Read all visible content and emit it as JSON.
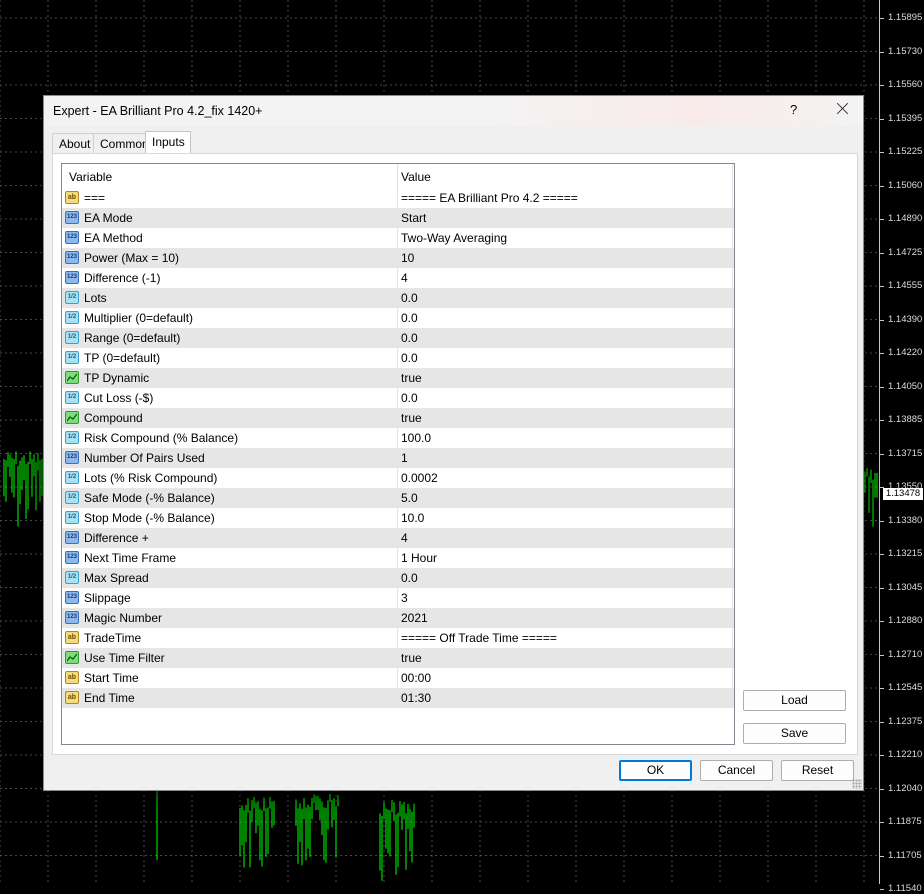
{
  "chart": {
    "price_labels": [
      "1.15895",
      "1.15730",
      "1.15560",
      "1.15395",
      "1.15225",
      "1.15060",
      "1.14890",
      "1.14725",
      "1.14555",
      "1.14390",
      "1.14220",
      "1.14050",
      "1.13885",
      "1.13715",
      "1.13550",
      "1.13380",
      "1.13215",
      "1.13045",
      "1.12880",
      "1.12710",
      "1.12545",
      "1.12375",
      "1.12210",
      "1.12040",
      "1.11875",
      "1.11705",
      "1.11540"
    ],
    "current_price": "1.13478",
    "candle_color": "#00ff00",
    "grid_color": "#4a4a4a"
  },
  "dialog": {
    "title": "Expert - EA Brilliant Pro 4.2_fix 1420+",
    "help": "?",
    "close_icon": "close-icon"
  },
  "tabs": [
    {
      "label": "About",
      "active": false
    },
    {
      "label": "Common",
      "active": false
    },
    {
      "label": "Inputs",
      "active": true
    }
  ],
  "grid": {
    "header_variable": "Variable",
    "header_value": "Value",
    "rows": [
      {
        "type": "ab",
        "variable": "===",
        "value": "===== EA Brilliant Pro 4.2 ====="
      },
      {
        "type": "int",
        "variable": "EA Mode",
        "value": "Start"
      },
      {
        "type": "int",
        "variable": "EA Method",
        "value": "Two-Way Averaging"
      },
      {
        "type": "int",
        "variable": "Power (Max = 10)",
        "value": "10"
      },
      {
        "type": "int",
        "variable": "Difference (-1)",
        "value": "4"
      },
      {
        "type": "dbl",
        "variable": "Lots",
        "value": "0.0"
      },
      {
        "type": "dbl",
        "variable": "Multiplier  (0=default)",
        "value": "0.0"
      },
      {
        "type": "dbl",
        "variable": "Range  (0=default)",
        "value": "0.0"
      },
      {
        "type": "dbl",
        "variable": "TP  (0=default)",
        "value": "0.0"
      },
      {
        "type": "bool",
        "variable": "TP Dynamic",
        "value": "true"
      },
      {
        "type": "dbl",
        "variable": "Cut Loss (-$)",
        "value": "0.0"
      },
      {
        "type": "bool",
        "variable": "Compound",
        "value": "true"
      },
      {
        "type": "dbl",
        "variable": "Risk Compound (% Balance)",
        "value": "100.0"
      },
      {
        "type": "int",
        "variable": "Number Of Pairs Used",
        "value": "1"
      },
      {
        "type": "dbl",
        "variable": "Lots (% Risk Compound)",
        "value": "0.0002"
      },
      {
        "type": "dbl",
        "variable": "Safe Mode (-% Balance)",
        "value": "5.0"
      },
      {
        "type": "dbl",
        "variable": "Stop Mode (-% Balance)",
        "value": "10.0"
      },
      {
        "type": "int",
        "variable": "Difference +",
        "value": "4"
      },
      {
        "type": "int",
        "variable": "Next Time Frame",
        "value": "1 Hour"
      },
      {
        "type": "dbl",
        "variable": "Max Spread",
        "value": "0.0"
      },
      {
        "type": "int",
        "variable": "Slippage",
        "value": "3"
      },
      {
        "type": "int",
        "variable": "Magic Number",
        "value": "2021"
      },
      {
        "type": "ab",
        "variable": "TradeTime",
        "value": "===== Off Trade Time ====="
      },
      {
        "type": "bool",
        "variable": "Use Time Filter",
        "value": "true"
      },
      {
        "type": "ab",
        "variable": "Start Time",
        "value": "00:00"
      },
      {
        "type": "ab",
        "variable": "End Time",
        "value": "01:30"
      }
    ]
  },
  "side_buttons": {
    "load": "Load",
    "save": "Save"
  },
  "footer_buttons": {
    "ok": "OK",
    "cancel": "Cancel",
    "reset": "Reset"
  },
  "type_icon_text": {
    "ab": "ab",
    "int": "123",
    "dbl": "1/2"
  }
}
